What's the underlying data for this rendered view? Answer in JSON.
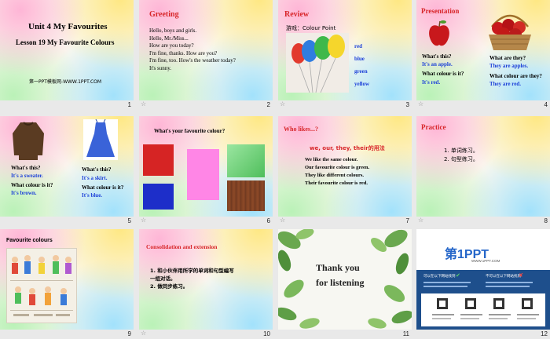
{
  "slides": [
    {
      "num": "1",
      "title": "Unit 4  My Favourites",
      "subtitle": "Lesson 19  My Favourite Colours",
      "site": "第一PPT模板网-WWW.1PPT.COM"
    },
    {
      "num": "2",
      "title": "Greeting",
      "lines": [
        "Hello, boys and girls.",
        "Hello, Mr./Miss...",
        "How are you today?",
        "I'm fine, thanks. How are you?",
        "I'm fine, too.  How's the weather today?",
        "It's sunny."
      ]
    },
    {
      "num": "3",
      "title": "Review",
      "game": "游戏：Colour Point",
      "colors": [
        "red",
        "blue",
        "green",
        "yellow"
      ]
    },
    {
      "num": "4",
      "title": "Presentation",
      "q1": "What's this?",
      "a1": "It's an apple.",
      "q2": "What colour is it?",
      "a2": "It's red.",
      "q3": "What are they?",
      "a3": "They are apples.",
      "q4": "What colour are they?",
      "a4": "They are red."
    },
    {
      "num": "5",
      "q1": "What's this?",
      "a1": "It's a sweater.",
      "q2": "What colour is it?",
      "a2": "It's brown.",
      "q3": "What's this?",
      "a3": "It's a skirt.",
      "q4": "What colour is it?",
      "a4": "It's blue."
    },
    {
      "num": "6",
      "question": "What's your favourite colour?"
    },
    {
      "num": "7",
      "title": "Who likes...?",
      "rule": "we, our, they, their的用法",
      "lines": [
        "We like the same colour.",
        "Our favourite  colour is green.",
        "They like different  colours.",
        "Their favourite  colour is red."
      ]
    },
    {
      "num": "8",
      "title": "Practice",
      "items": [
        "1. 单词练习。",
        "2. 句型练习。"
      ]
    },
    {
      "num": "9",
      "title": "Favourite colours"
    },
    {
      "num": "10",
      "title": "Consolidation and extension",
      "items": [
        "1. 和小伙伴用所学的单词和句型编写",
        "一组对话。",
        "2. 做同步练习。"
      ]
    },
    {
      "num": "11",
      "line1": "Thank you",
      "line2": "for listening"
    },
    {
      "num": "12",
      "logo_main": "第1PPT",
      "logo_sub": "WWW.1PPT.COM",
      "note_left": "可以在以下网站找到",
      "note_right": "不可以在以下网站找到"
    }
  ],
  "colors": {
    "accent_red": "#d8262a",
    "answer_blue": "#1b3fd8"
  }
}
